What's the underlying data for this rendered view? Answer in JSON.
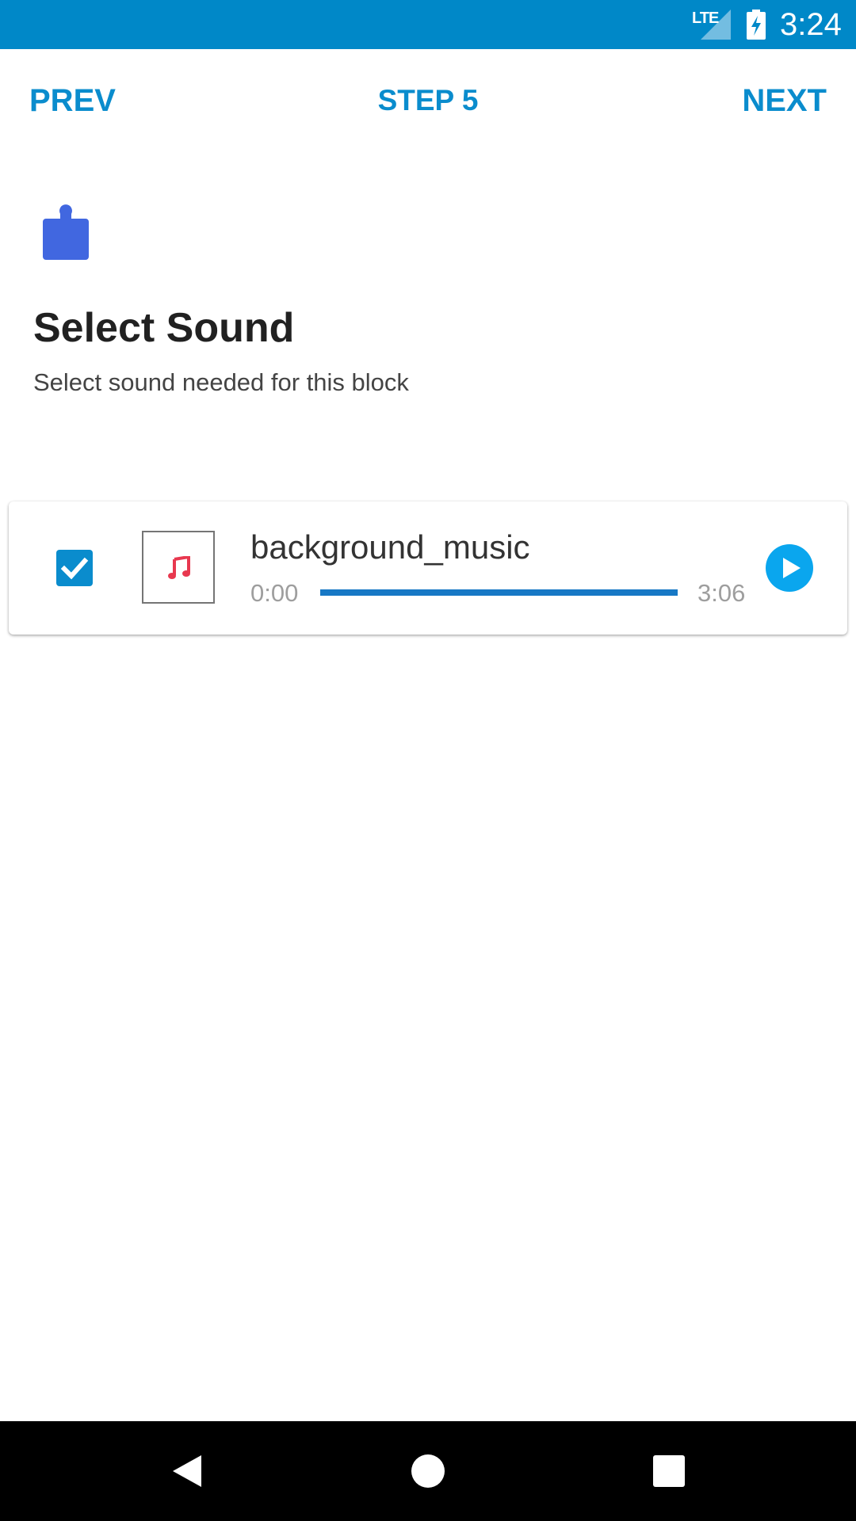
{
  "status_bar": {
    "network": "LTE",
    "time": "3:24",
    "background_color": "#0088c8"
  },
  "top_nav": {
    "prev_label": "PREV",
    "step_label": "STEP 5",
    "next_label": "NEXT",
    "accent_color": "#0a8ccd"
  },
  "header": {
    "icon": "puzzle-piece-icon",
    "title": "Select Sound",
    "subtitle": "Select sound needed for this block"
  },
  "sounds": [
    {
      "name": "background_music",
      "selected": true,
      "thumbnail_icon": "music-note-icon",
      "current_time": "0:00",
      "duration": "3:06",
      "progress_percent": 100,
      "play_icon": "play-icon"
    }
  ],
  "system_nav": {
    "back_icon": "back-icon",
    "home_icon": "home-icon",
    "recents_icon": "recents-icon"
  }
}
